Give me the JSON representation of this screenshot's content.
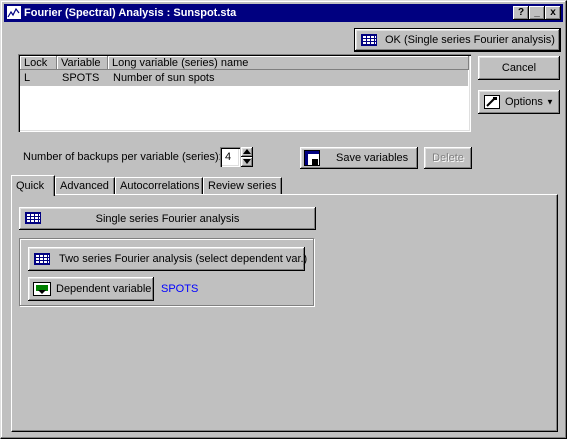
{
  "window": {
    "title": "Fourier (Spectral) Analysis : Sunspot.sta",
    "help_btn": "?",
    "min_btn": "_",
    "close_btn": "x"
  },
  "buttons": {
    "ok": "OK (Single series Fourier analysis)",
    "cancel": "Cancel",
    "options": "Options",
    "save_variables": "Save variables",
    "delete": "Delete"
  },
  "table": {
    "headers": [
      "Lock",
      "Variable",
      "Long variable (series) name"
    ],
    "rows": [
      {
        "lock": "L",
        "variable": "SPOTS",
        "name": "Number of sun spots"
      }
    ]
  },
  "backups": {
    "label": "Number of backups per variable (series):",
    "value": "4"
  },
  "tabs": [
    "Quick",
    "Advanced",
    "Autocorrelations",
    "Review series"
  ],
  "active_tab": "Quick",
  "quick": {
    "single_series": "Single series Fourier analysis",
    "two_series": "Two series Fourier analysis (select dependent var.)",
    "dependent_variable_btn": "Dependent variable",
    "dependent_variable_value": "SPOTS",
    "dependent_value_color": "#0000ff"
  },
  "colors": {
    "titlebar": "#000080",
    "face": "#c0c0c0"
  }
}
